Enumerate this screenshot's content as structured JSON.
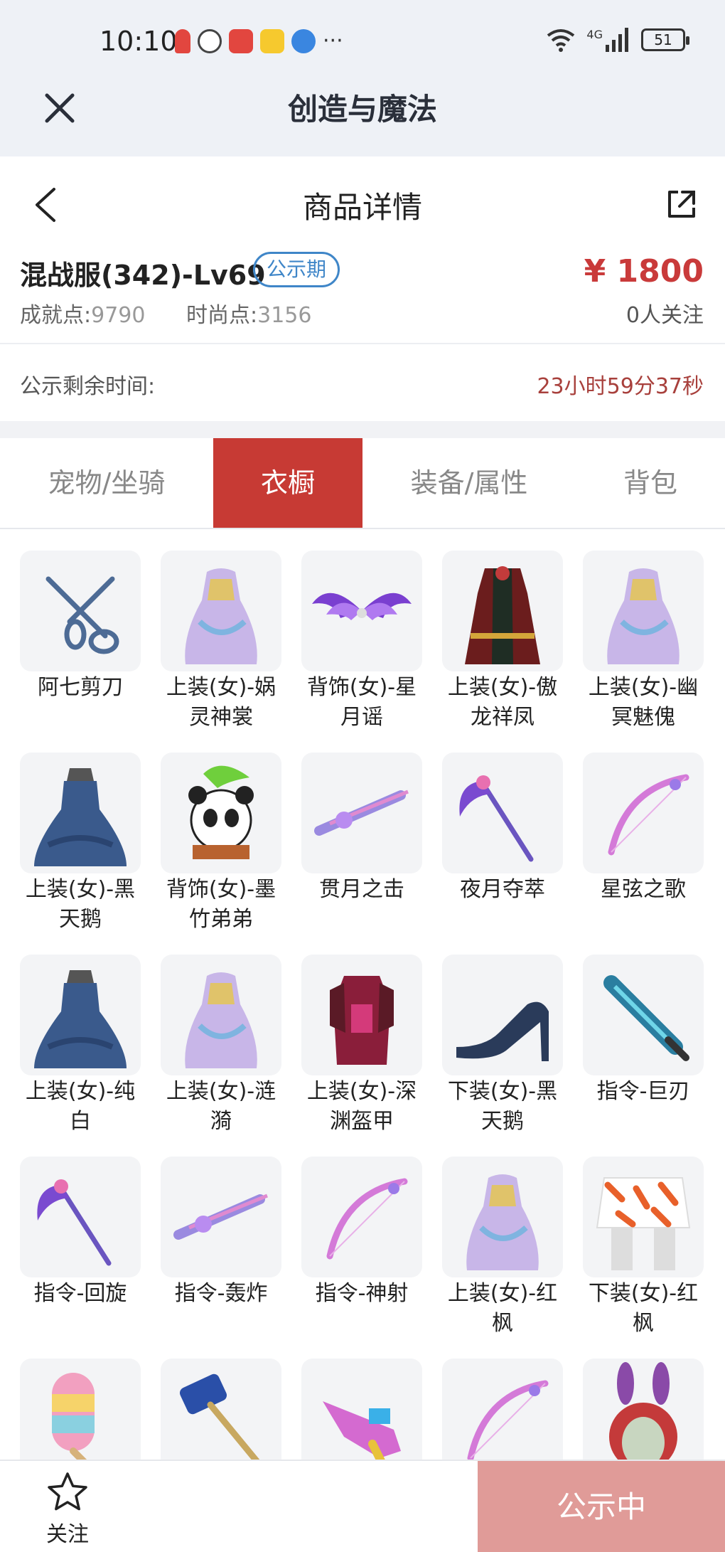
{
  "status_bar": {
    "time": "10:10",
    "network": "4G",
    "battery": "51"
  },
  "app_bar": {
    "title": "创造与魔法"
  },
  "nav": {
    "title": "商品详情"
  },
  "product": {
    "name": "混战服(342)-Lv69",
    "badge": "公示期",
    "price": "¥ 1800",
    "achievement_label": "成就点:",
    "achievement_value": "9790",
    "fashion_label": "时尚点:",
    "fashion_value": "3156",
    "followers": "0人关注"
  },
  "notice": {
    "label": "公示剩余时间:",
    "time": "23小时59分37秒"
  },
  "tabs": [
    {
      "label": "宠物/坐骑",
      "active": false
    },
    {
      "label": "衣橱",
      "active": true
    },
    {
      "label": "装备/属性",
      "active": false
    },
    {
      "label": "背包",
      "active": false
    }
  ],
  "items": [
    {
      "line1": "阿七剪刀",
      "line2": "",
      "icon": "scissors-icon"
    },
    {
      "line1": "上装(女)-娲",
      "line2": "灵神裳",
      "icon": "dress-icon"
    },
    {
      "line1": "背饰(女)-星",
      "line2": "月谣",
      "icon": "wings-icon"
    },
    {
      "line1": "上装(女)-傲",
      "line2": "龙祥凤",
      "icon": "robe-icon"
    },
    {
      "line1": "上装(女)-幽",
      "line2": "冥魅傀",
      "icon": "dress-icon"
    },
    {
      "line1": "上装(女)-黑",
      "line2": "天鹅",
      "icon": "gown-icon"
    },
    {
      "line1": "背饰(女)-墨",
      "line2": "竹弟弟",
      "icon": "panda-icon"
    },
    {
      "line1": "贯月之击",
      "line2": "",
      "icon": "weapon-icon"
    },
    {
      "line1": "夜月夺萃",
      "line2": "",
      "icon": "scythe-icon"
    },
    {
      "line1": "星弦之歌",
      "line2": "",
      "icon": "bow-icon"
    },
    {
      "line1": "上装(女)-纯",
      "line2": "白",
      "icon": "gown-icon"
    },
    {
      "line1": "上装(女)-涟",
      "line2": "漪",
      "icon": "dress-icon"
    },
    {
      "line1": "上装(女)-深",
      "line2": "渊盔甲",
      "icon": "armor-icon"
    },
    {
      "line1": "下装(女)-黑",
      "line2": "天鹅",
      "icon": "heels-icon"
    },
    {
      "line1": "指令-巨刃",
      "line2": "",
      "icon": "sword-icon"
    },
    {
      "line1": "指令-回旋",
      "line2": "",
      "icon": "scythe-icon"
    },
    {
      "line1": "指令-轰炸",
      "line2": "",
      "icon": "weapon-icon"
    },
    {
      "line1": "指令-神射",
      "line2": "",
      "icon": "bow-icon"
    },
    {
      "line1": "上装(女)-红",
      "line2": "枫",
      "icon": "dress-icon"
    },
    {
      "line1": "下装(女)-红",
      "line2": "枫",
      "icon": "skirt-icon"
    },
    {
      "line1": "",
      "line2": "",
      "icon": "popsicle-icon"
    },
    {
      "line1": "",
      "line2": "",
      "icon": "hammer-icon"
    },
    {
      "line1": "",
      "line2": "",
      "icon": "water-gun-icon"
    },
    {
      "line1": "",
      "line2": "",
      "icon": "bow-icon"
    },
    {
      "line1": "",
      "line2": "",
      "icon": "bunny-hood-icon"
    }
  ],
  "bottom_bar": {
    "follow_label": "关注",
    "public_button": "公示中"
  }
}
